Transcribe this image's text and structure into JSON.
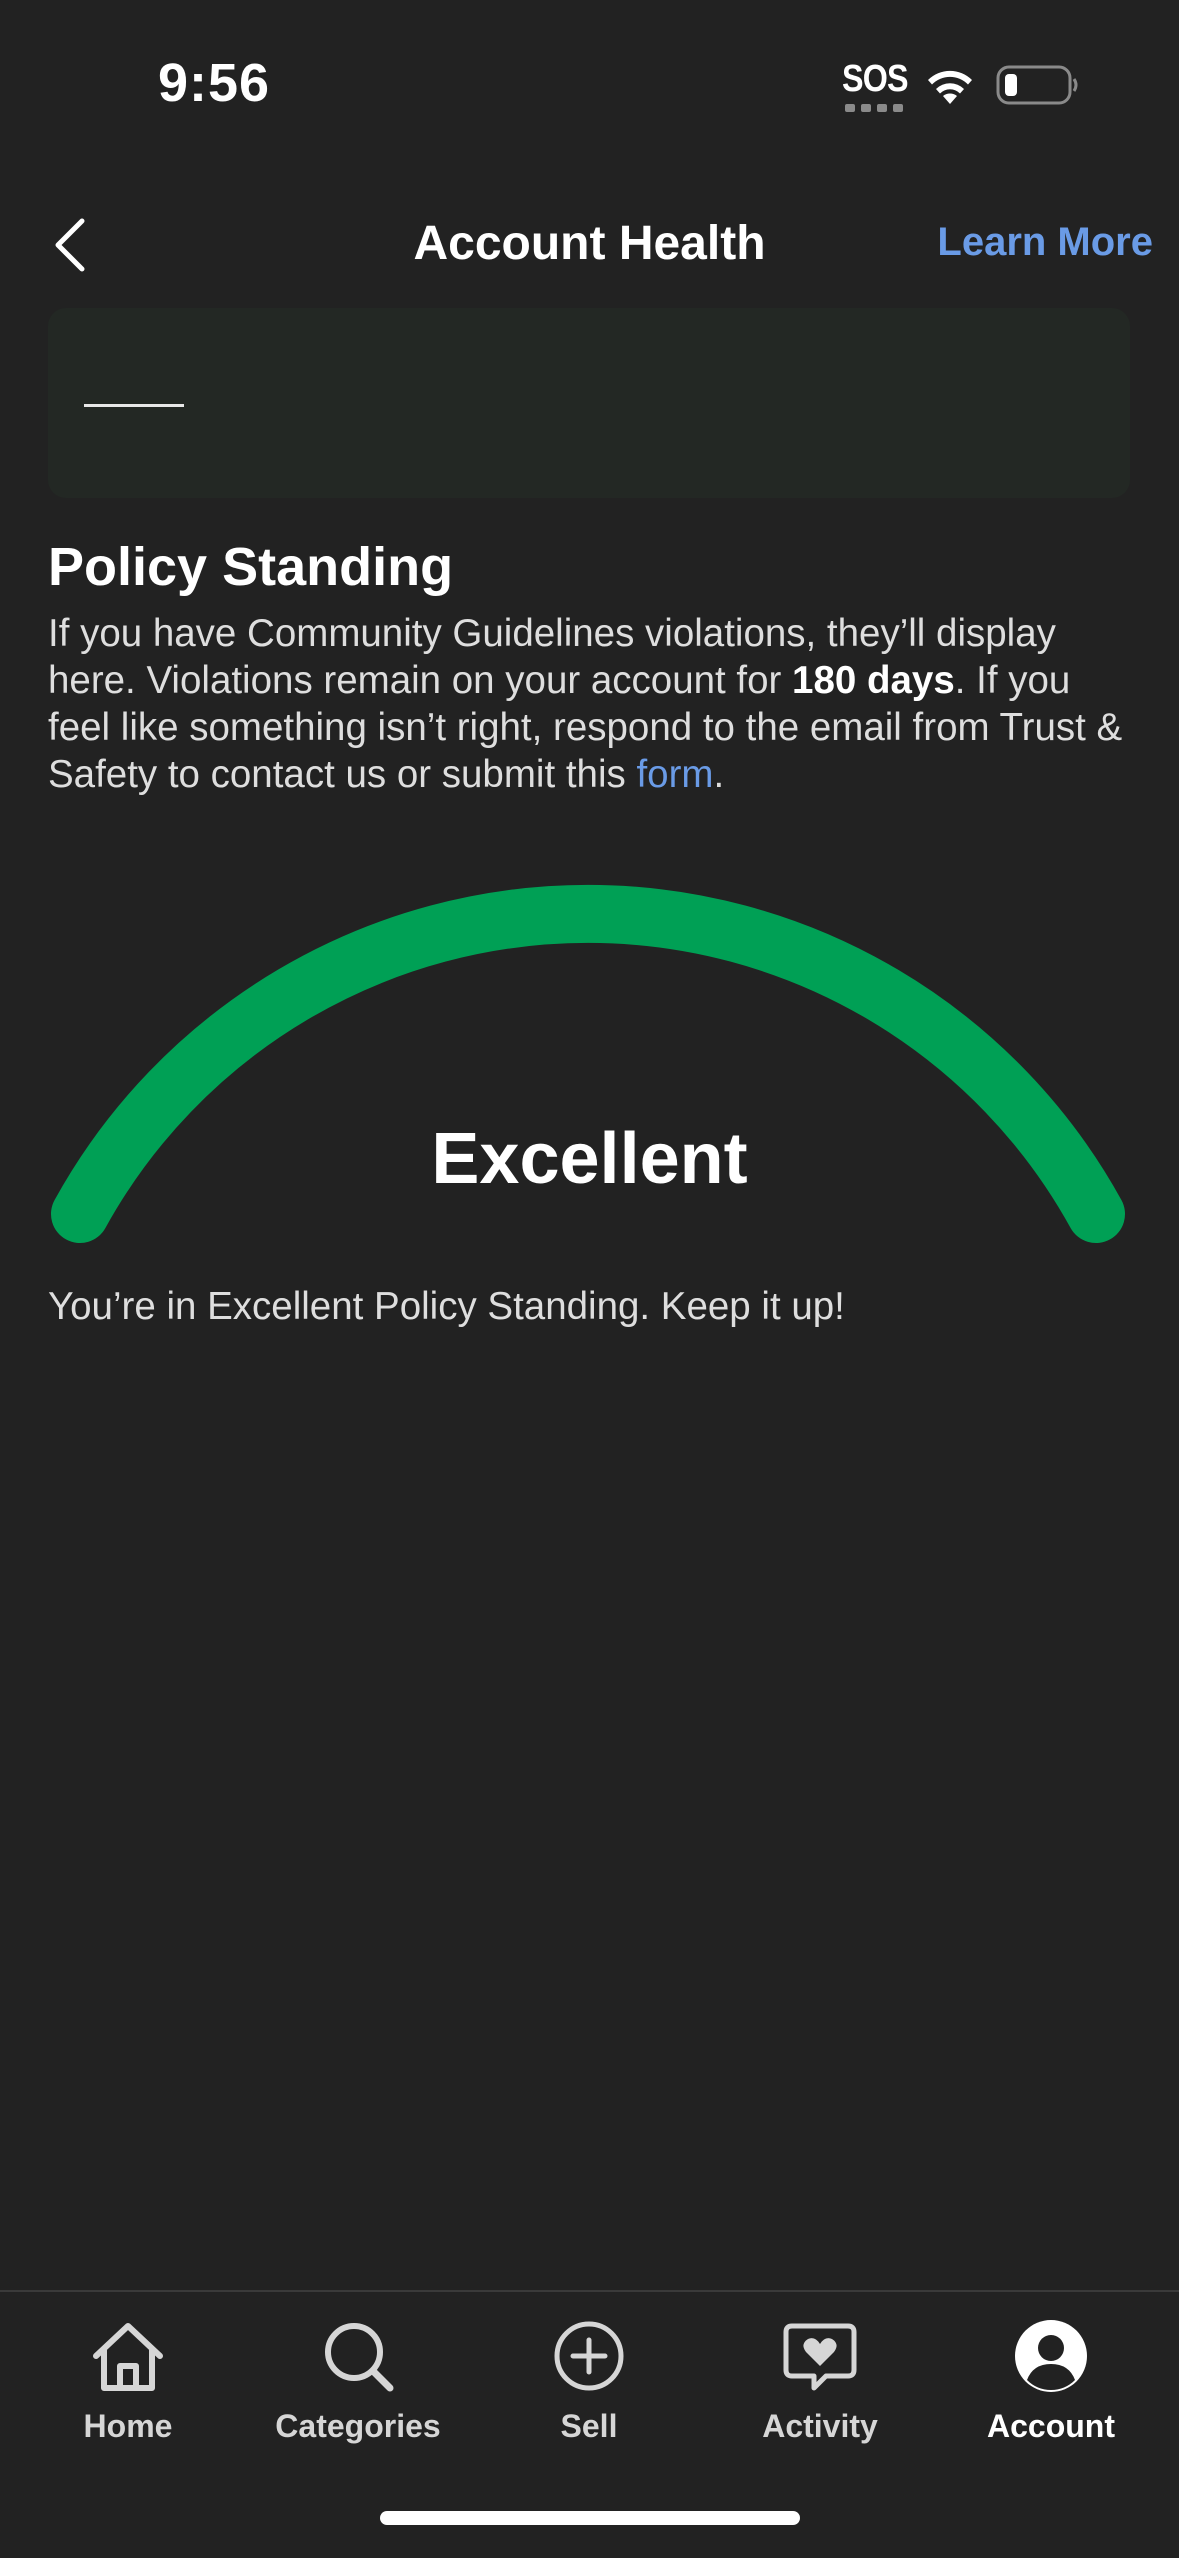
{
  "status_bar": {
    "time": "9:56",
    "sos": "SOS"
  },
  "nav": {
    "title": "Account Health",
    "learn_more": "Learn More"
  },
  "policy": {
    "title": "Policy Standing",
    "desc_part1": "If you have Community Guidelines violations, they’ll display here. Violations remain on your account for ",
    "desc_bold": "180 days",
    "desc_part2": ". If you feel like something isn’t right, respond to the email from Trust & Safety to contact us or submit this ",
    "desc_link": "form",
    "desc_end": "."
  },
  "gauge": {
    "label": "Excellent",
    "note": "You’re in Excellent Policy Standing. Keep it up!",
    "color": "#00a055"
  },
  "tabs": [
    {
      "label": "Home",
      "icon": "home-icon"
    },
    {
      "label": "Categories",
      "icon": "search-icon"
    },
    {
      "label": "Sell",
      "icon": "plus-circle-icon"
    },
    {
      "label": "Activity",
      "icon": "heart-chat-icon"
    },
    {
      "label": "Account",
      "icon": "account-icon",
      "active": true
    }
  ],
  "colors": {
    "background": "#222222",
    "accent_link": "#6a9be6",
    "gauge_green": "#00a055"
  }
}
